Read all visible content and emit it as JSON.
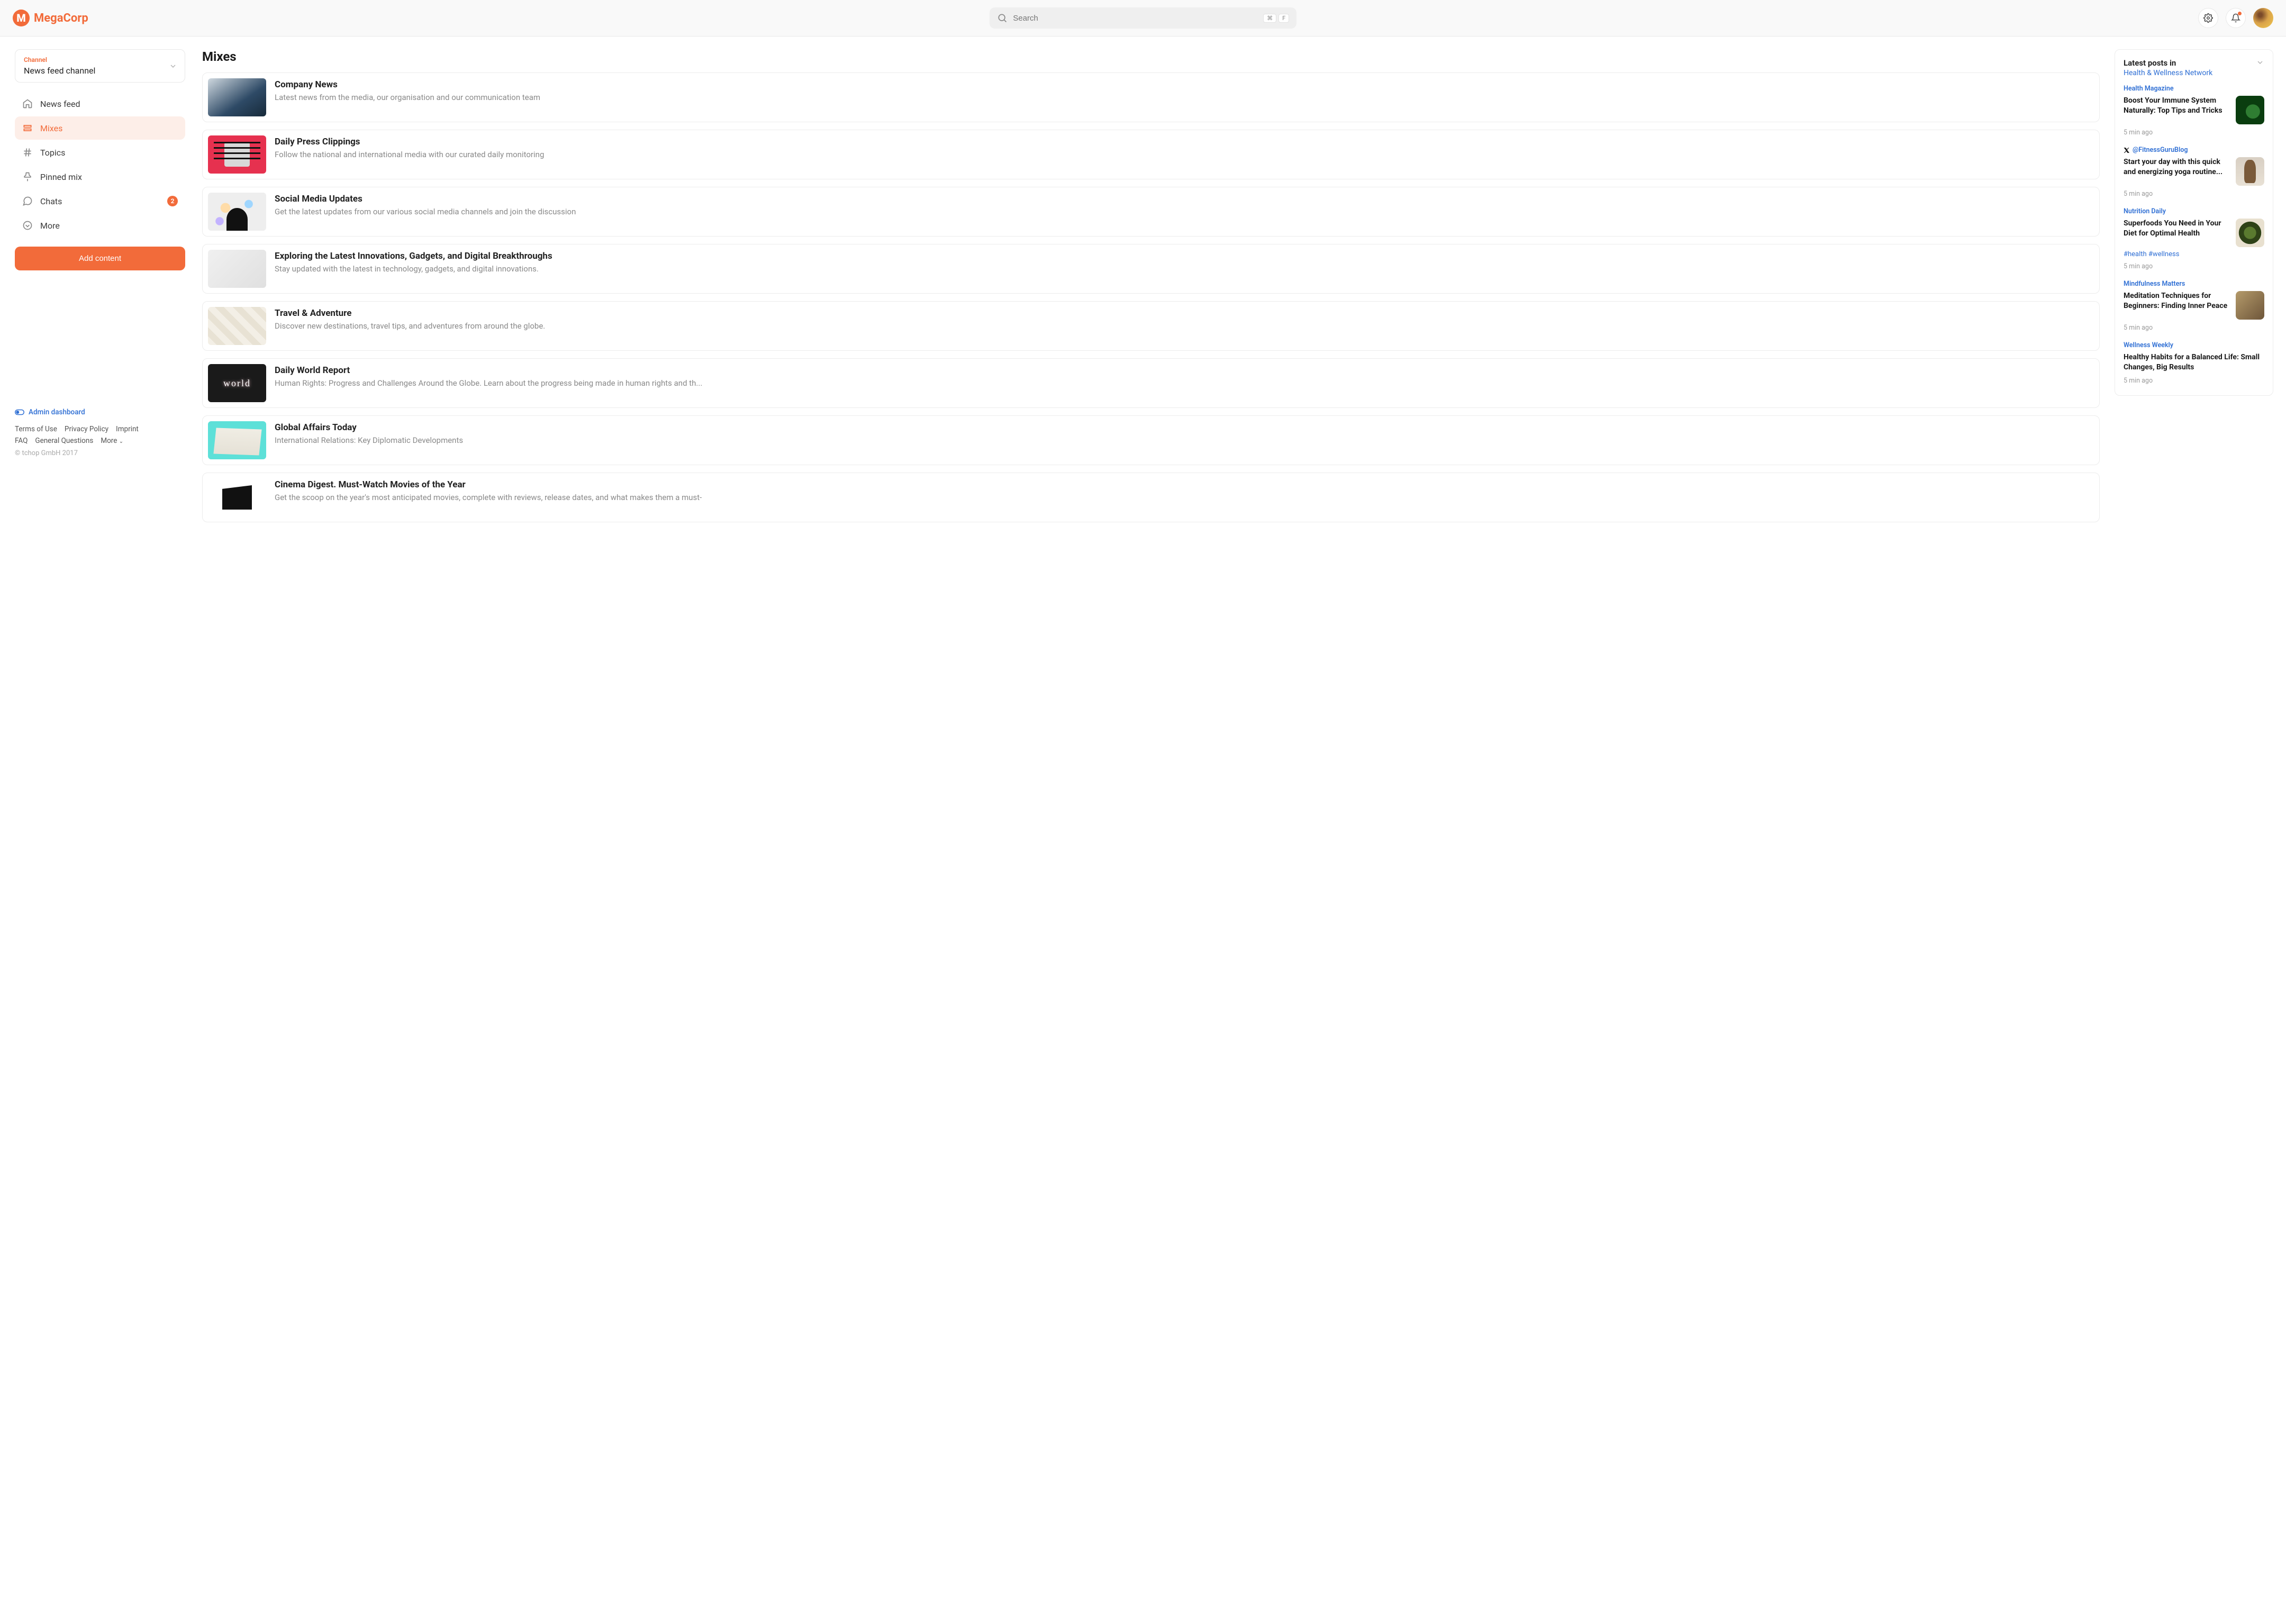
{
  "brand": "MegaCorp",
  "search": {
    "placeholder": "Search",
    "kbd1": "⌘",
    "kbd2": "F"
  },
  "channel": {
    "label": "Channel",
    "value": "News feed channel"
  },
  "nav": {
    "items": [
      {
        "label": "News feed"
      },
      {
        "label": "Mixes"
      },
      {
        "label": "Topics"
      },
      {
        "label": "Pinned mix"
      },
      {
        "label": "Chats",
        "badge": "2"
      },
      {
        "label": "More"
      }
    ]
  },
  "add_button": "Add content",
  "footer": {
    "admin": "Admin dashboard",
    "links1": [
      "Terms of Use",
      "Privacy Policy",
      "Imprint"
    ],
    "links2": [
      "FAQ",
      "General Questions",
      "More"
    ],
    "copyright": "© tchop GmbH 2017"
  },
  "main_title": "Mixes",
  "mixes": [
    {
      "title": "Company News",
      "desc": "Latest news from the media, our organisation and our communication team"
    },
    {
      "title": "Daily Press Clippings",
      "desc": "Follow the national and international media with our curated daily monitoring"
    },
    {
      "title": "Social Media Updates",
      "desc": "Get the latest updates from our various social media channels and join the discussion"
    },
    {
      "title": "Exploring the Latest Innovations, Gadgets, and Digital Breakthroughs",
      "desc": "Stay updated with the latest in technology, gadgets, and digital innovations."
    },
    {
      "title": "Travel & Adventure",
      "desc": "Discover new destinations, travel tips, and adventures from around the globe."
    },
    {
      "title": "Daily World Report",
      "desc": "Human Rights: Progress and Challenges Around the Globe. Learn about the progress being made in human rights and th..."
    },
    {
      "title": "Global Affairs Today",
      "desc": "International Relations: Key Diplomatic Developments"
    },
    {
      "title": "Cinema Digest. Must-Watch Movies of the Year",
      "desc": "Get the scoop on the year's most anticipated movies, complete with reviews, release dates, and what makes them a must-"
    }
  ],
  "panel": {
    "h1": "Latest posts in",
    "h2": "Health & Wellness Network",
    "posts": [
      {
        "source": "Health Magazine",
        "title": "Boost Your Immune System Naturally: Top Tips and Tricks",
        "time": "5 min ago",
        "has_thumb": true
      },
      {
        "source": "@FitnessGuruBlog",
        "title": "Start your day with this quick and energizing yoga routine...",
        "time": "5 min ago",
        "has_thumb": true,
        "twitter": true
      },
      {
        "source": "Nutrition Daily",
        "title": "Superfoods You Need in Your Diet for Optimal Health",
        "tags": "#health #wellness",
        "time": "5 min ago",
        "has_thumb": true
      },
      {
        "source": "Mindfulness Matters",
        "title": "Meditation Techniques for Beginners: Finding Inner Peace",
        "time": "5 min ago",
        "has_thumb": true
      },
      {
        "source": "Wellness Weekly",
        "title": "Healthy Habits for a Balanced Life: Small Changes, Big Results",
        "time": "5 min ago",
        "has_thumb": false
      }
    ]
  }
}
